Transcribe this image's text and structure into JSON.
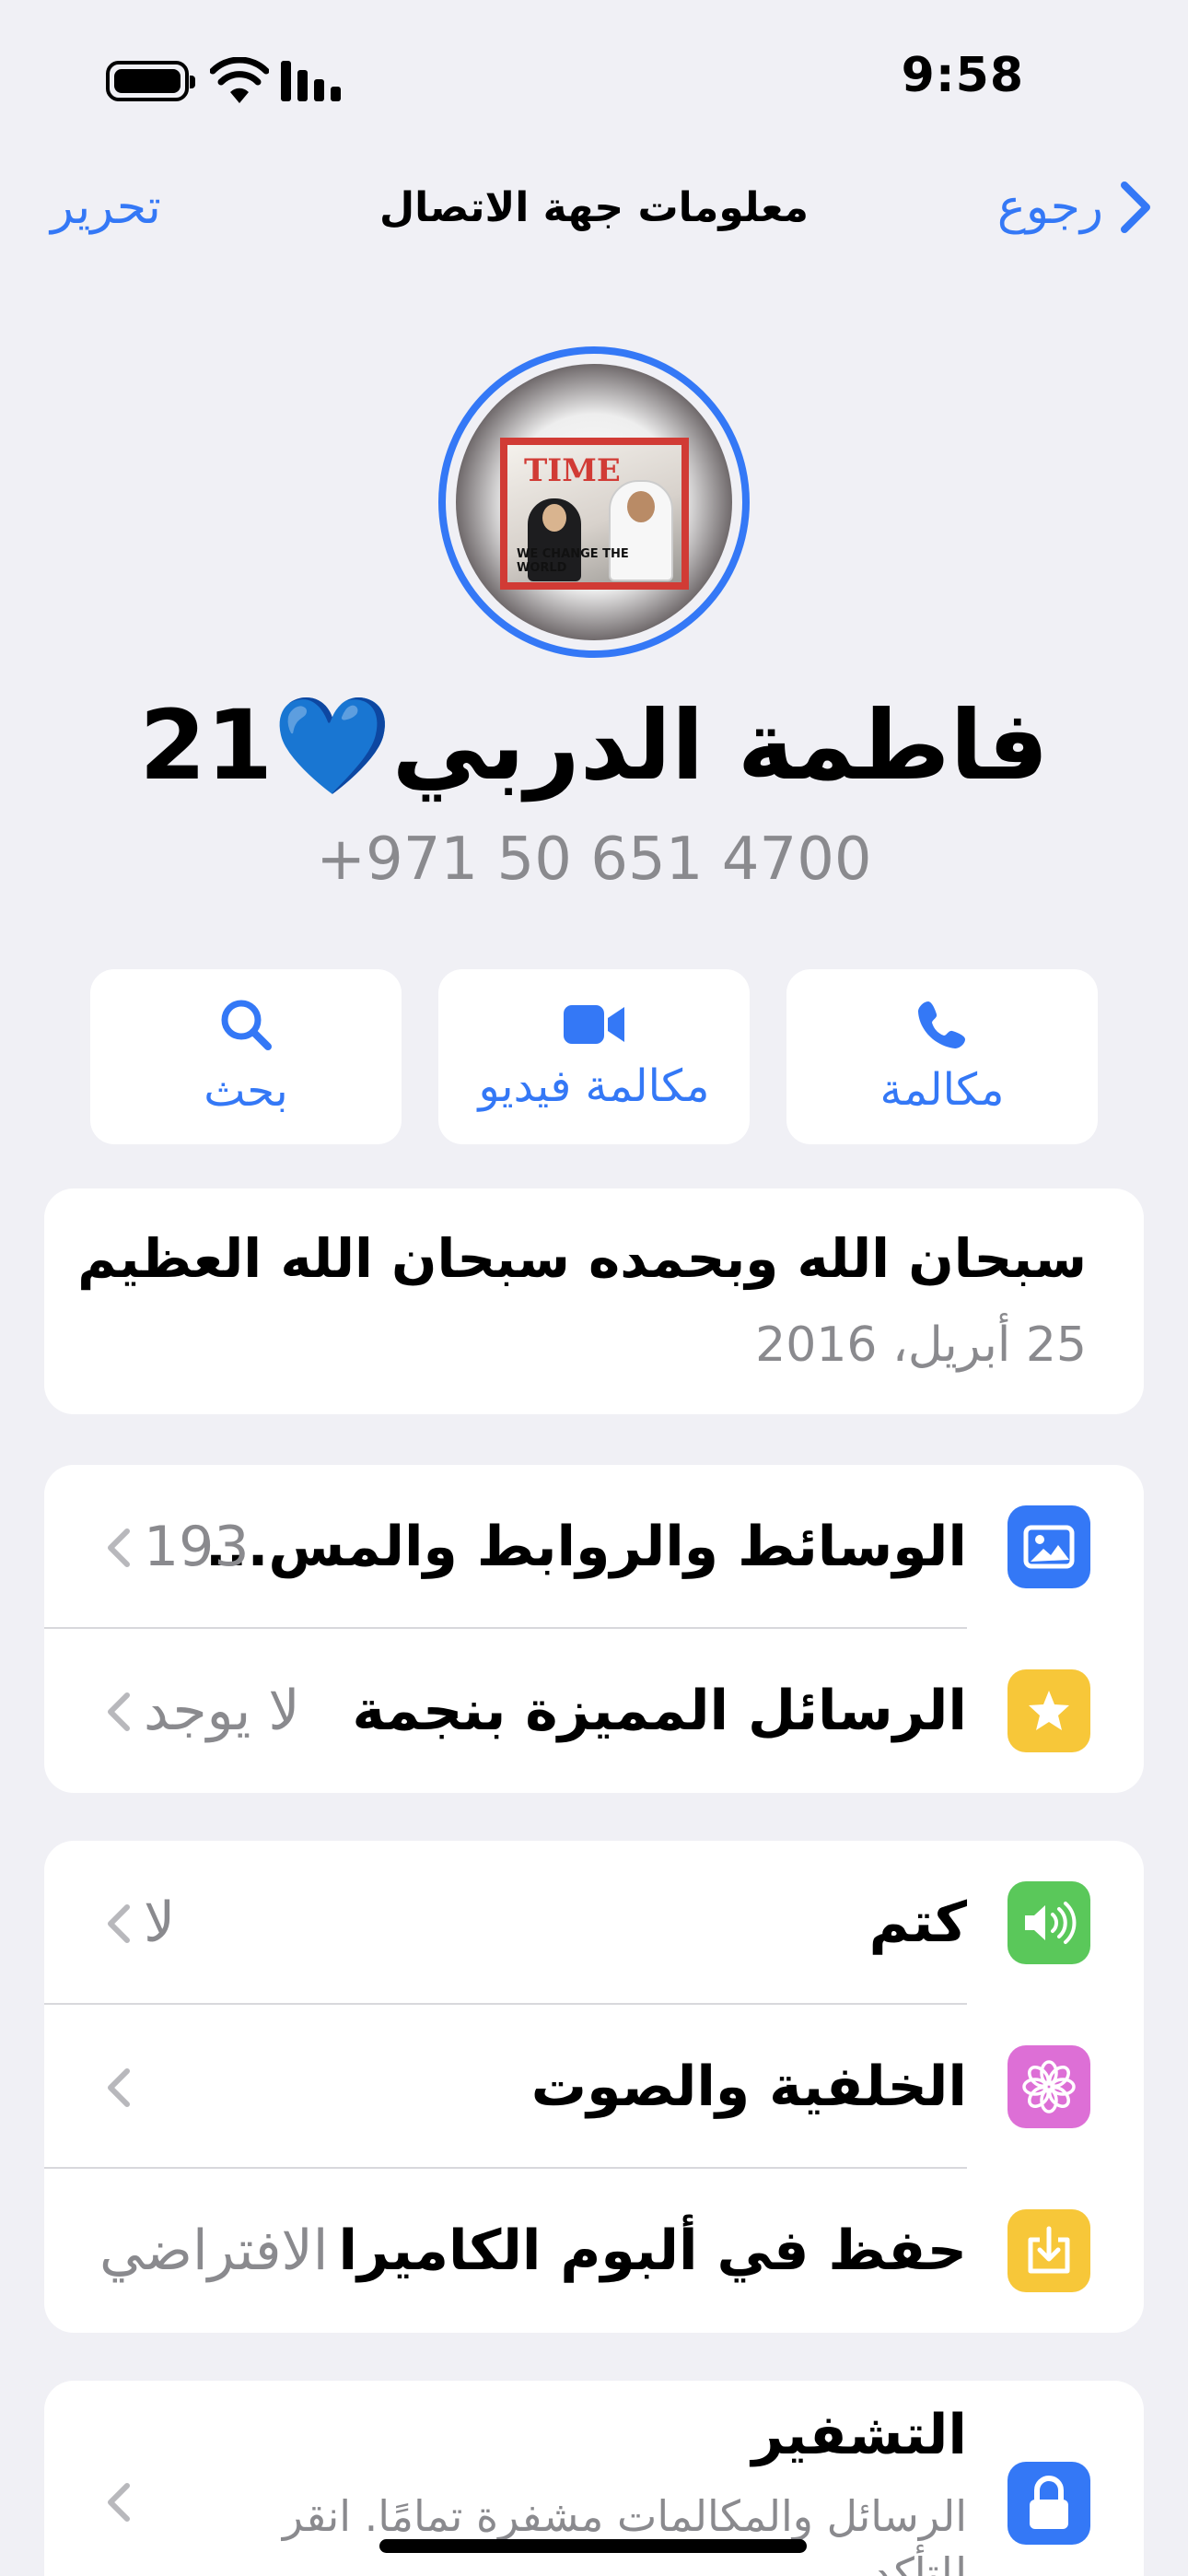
{
  "status_bar": {
    "time": "9:58"
  },
  "nav": {
    "back_label": "رجوع",
    "title": "معلومات جهة الاتصال",
    "edit_label": "تحرير"
  },
  "contact": {
    "name": "فاطمة الدربي💙21",
    "phone": "+971 50 651 4700"
  },
  "avatar_text": {
    "mag_title": "TIME",
    "mag_sub": "WE CHANGE THE WORLD"
  },
  "actions": [
    {
      "label": "مكالمة",
      "icon": "phone-icon"
    },
    {
      "label": "مكالمة فيديو",
      "icon": "video-icon"
    },
    {
      "label": "بحث",
      "icon": "search-icon"
    }
  ],
  "about": {
    "text": "سبحان الله وبحمده سبحان الله العظيم",
    "date": "25 أبريل، 2016"
  },
  "media_rows": [
    {
      "label": "الوسائط والروابط والمس...",
      "value": "193",
      "icon": "photo-icon",
      "color": "#3478f6"
    },
    {
      "label": "الرسائل المميزة بنجمة",
      "value": "لا يوجد",
      "icon": "star-icon",
      "color": "#f7c739"
    }
  ],
  "settings_rows": [
    {
      "label": "كتم",
      "value": "لا",
      "icon": "speaker-icon",
      "color": "#5ac85a"
    },
    {
      "label": "الخلفية والصوت",
      "value": "",
      "icon": "flower-icon",
      "color": "#dd6fd6"
    },
    {
      "label": "حفظ في ألبوم الكاميرا",
      "value": "الافتراضي",
      "icon": "save-icon",
      "color": "#f7c739"
    }
  ],
  "encryption": {
    "title": "التشفير",
    "subtitle": "الرسائل والمكالمات مشفرة تمامًا. انقر للتأكد.",
    "icon": "lock-icon",
    "color": "#3478f6"
  }
}
